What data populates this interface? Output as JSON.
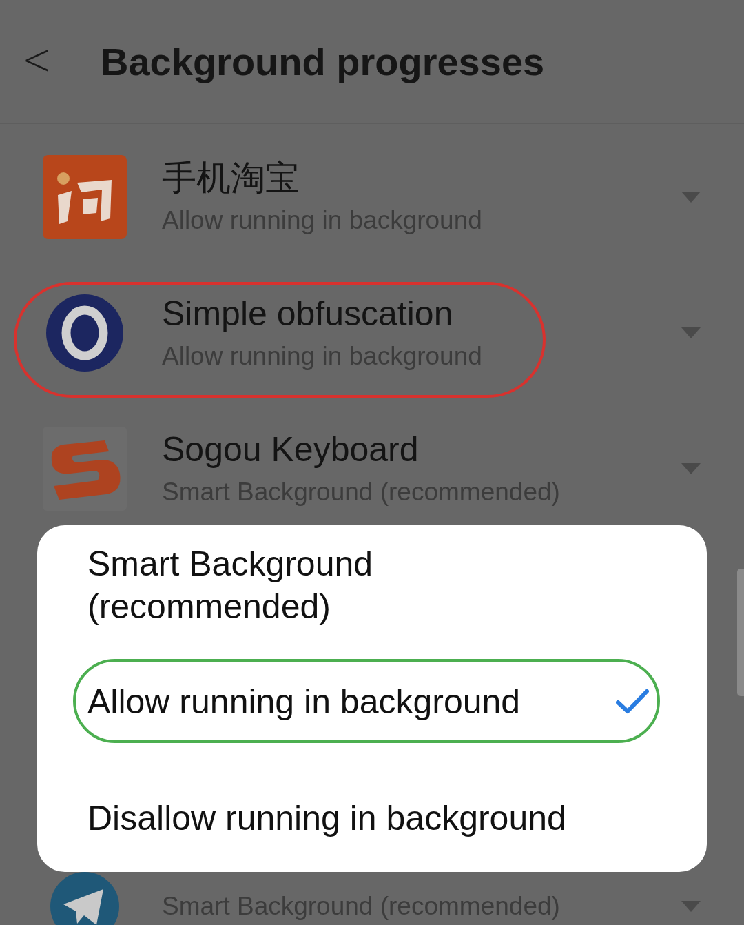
{
  "header": {
    "back": "<",
    "title": "Background progresses"
  },
  "apps": [
    {
      "name": "手机淘宝",
      "status": "Allow running in background",
      "circled": false
    },
    {
      "name": "Simple obfuscation",
      "status": "Allow running in background",
      "circled": true
    },
    {
      "name": "Sogou Keyboard",
      "status": "Smart Background (recommended)",
      "circled": false
    },
    {
      "status": "Smart Background (recommended)",
      "circled": false
    }
  ],
  "dialog": {
    "options": [
      {
        "label": "Smart Background (recommended)",
        "selected": false,
        "circled": false
      },
      {
        "label": "Allow running in background",
        "selected": true,
        "circled": true
      },
      {
        "label": "Disallow running in background",
        "selected": false,
        "circled": false
      }
    ]
  }
}
